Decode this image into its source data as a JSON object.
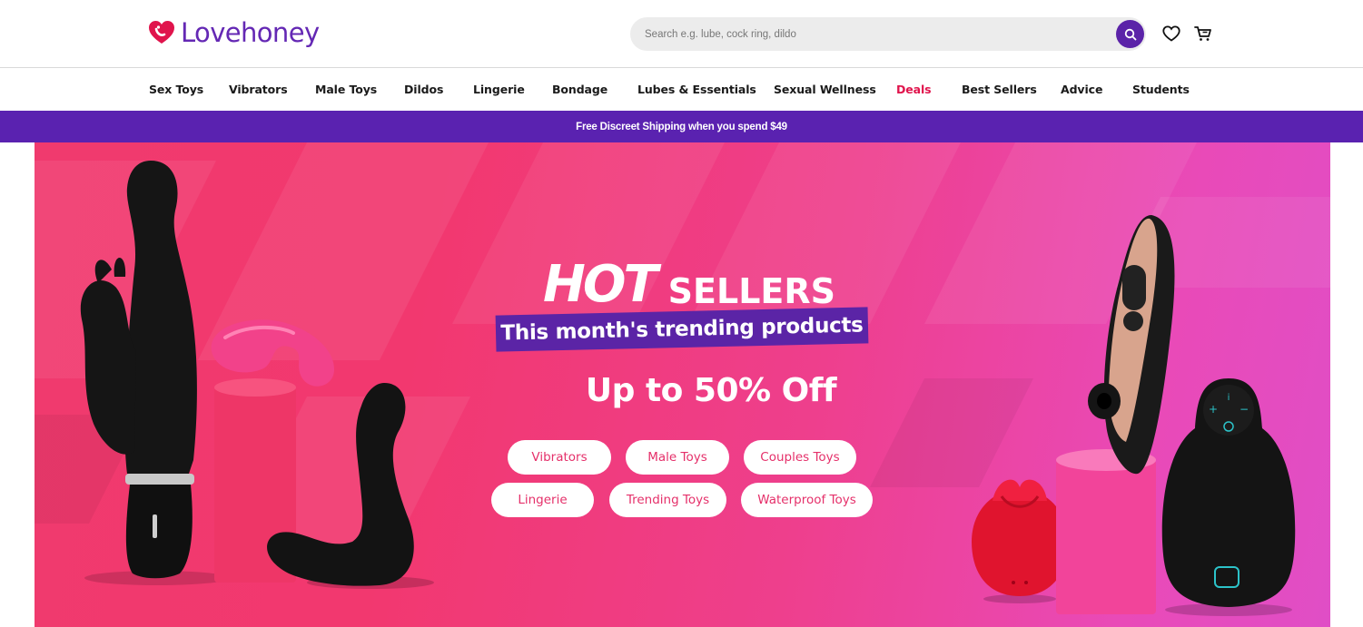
{
  "brand": {
    "name": "Lovehoney",
    "color": "#6428b4",
    "accent": "#e0144c"
  },
  "search": {
    "placeholder": "Search e.g. lube, cock ring, dildo",
    "value": ""
  },
  "header_icons": {
    "search": "search-icon",
    "wishlist": "heart-icon",
    "cart": "cart-icon"
  },
  "nav": {
    "items": [
      {
        "label": "Sex Toys"
      },
      {
        "label": "Vibrators"
      },
      {
        "label": "Male Toys"
      },
      {
        "label": "Dildos"
      },
      {
        "label": "Lingerie"
      },
      {
        "label": "Bondage"
      },
      {
        "label": "Lubes & Essentials"
      },
      {
        "label": "Sexual Wellness"
      },
      {
        "label": "Deals",
        "highlight": "#e0144c"
      },
      {
        "label": "Best Sellers"
      },
      {
        "label": "Advice"
      },
      {
        "label": "Students"
      }
    ]
  },
  "promo": {
    "text": "Free Discreet Shipping when you spend $49",
    "background": "#5a22b0"
  },
  "hero": {
    "title_hot": "HOT",
    "title_sellers": "SELLERS",
    "tagline": "This month's trending products",
    "offer": "Up to 50% Off",
    "buttons": [
      {
        "label": "Vibrators"
      },
      {
        "label": "Male Toys"
      },
      {
        "label": "Couples Toys"
      },
      {
        "label": "Lingerie"
      },
      {
        "label": "Trending Toys"
      },
      {
        "label": "Waterproof Toys"
      }
    ],
    "colors": {
      "background_start": "#f03a6e",
      "background_end": "#e04ec6",
      "tag": "#5b24a6",
      "pill_text": "#e5306a"
    }
  }
}
